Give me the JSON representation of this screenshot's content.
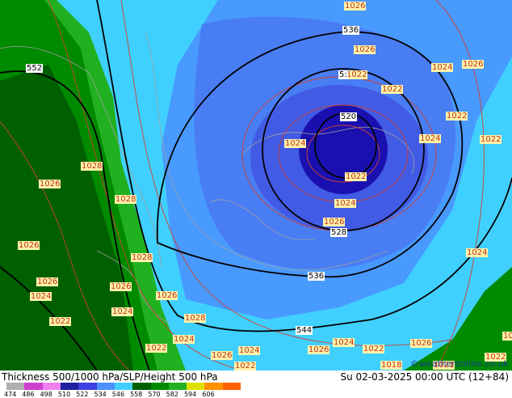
{
  "footer": {
    "title": "Thickness 500/1000 hPa/SLP/Height 500 hPa",
    "datetime": "Su 02-03-2025 00:00 UTC (12+84)",
    "credit": "©weatheronline.co.uk"
  },
  "scale": {
    "labels": [
      "474",
      "486",
      "498",
      "510",
      "522",
      "534",
      "546",
      "558",
      "570",
      "582",
      "594",
      "606"
    ],
    "colors": [
      "#b0b0b0",
      "#d040d0",
      "#f080f0",
      "#2020a0",
      "#4040e0",
      "#4a90ff",
      "#40d0ff",
      "#006000",
      "#008a00",
      "#20b020",
      "#e0e000",
      "#ff9000",
      "#ff6000"
    ]
  },
  "height_contours": [
    "520",
    "528",
    "536",
    "544",
    "552",
    "5:"
  ],
  "slp_isobars": [
    "1026",
    "1026",
    "1024",
    "1026",
    "1022",
    "1022",
    "1022",
    "1024",
    "1024",
    "1022",
    "1024",
    "1026",
    "1028",
    "1026",
    "1028",
    "1026",
    "1024",
    "1028",
    "1026",
    "1024",
    "1026",
    "1022",
    "1028",
    "1022",
    "1024",
    "1026",
    "1024",
    "1026",
    "1024",
    "1022",
    "1018",
    "1026",
    "1021",
    "1022",
    "1022",
    "1022",
    "1024",
    "1026",
    "102"
  ],
  "colors": {
    "slp_line": "#d04030",
    "height_line": "#000000",
    "coast": "#a0a0a0"
  }
}
